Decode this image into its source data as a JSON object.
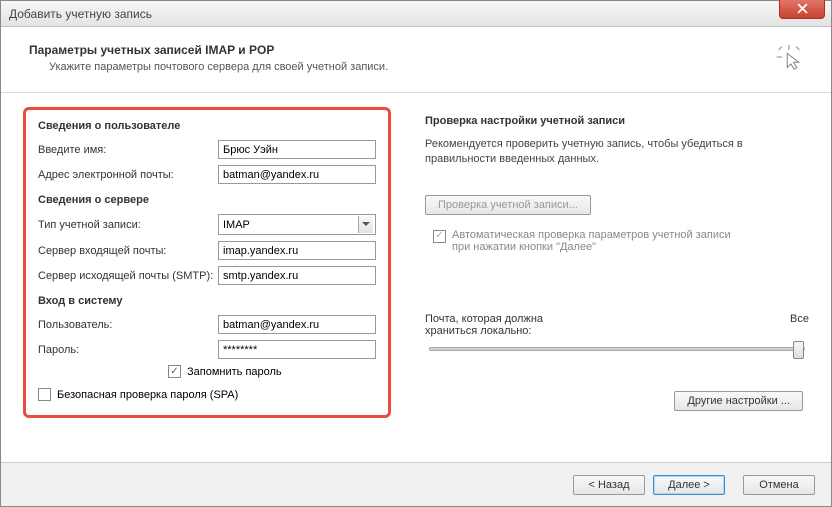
{
  "window": {
    "title": "Добавить учетную запись"
  },
  "header": {
    "title": "Параметры учетных записей IMAP и POP",
    "subtitle": "Укажите параметры почтового сервера для своей учетной записи."
  },
  "userSection": {
    "title": "Сведения о пользователе",
    "nameLabel": "Введите имя:",
    "nameValue": "Брюс Уэйн",
    "emailLabel": "Адрес электронной почты:",
    "emailValue": "batman@yandex.ru"
  },
  "serverSection": {
    "title": "Сведения о сервере",
    "typeLabel": "Тип учетной записи:",
    "typeValue": "IMAP",
    "incomingLabel": "Сервер входящей почты:",
    "incomingValue": "imap.yandex.ru",
    "outgoingLabel": "Сервер исходящей почты (SMTP):",
    "outgoingValue": "smtp.yandex.ru"
  },
  "loginSection": {
    "title": "Вход в систему",
    "userLabel": "Пользователь:",
    "userValue": "batman@yandex.ru",
    "passLabel": "Пароль:",
    "passValue": "********",
    "rememberLabel": "Запомнить пароль",
    "spaLabel": "Безопасная проверка пароля (SPA)"
  },
  "testSection": {
    "title": "Проверка настройки учетной записи",
    "desc": "Рекомендуется проверить учетную запись, чтобы убедиться в правильности введенных данных.",
    "testButton": "Проверка учетной записи...",
    "autoLabel": "Автоматическая проверка параметров учетной записи при нажатии кнопки \"Далее\""
  },
  "slider": {
    "leftLabel": "Почта, которая должна храниться локально:",
    "rightLabel": "Все"
  },
  "otherSettings": "Другие настройки ...",
  "footer": {
    "back": "< Назад",
    "next": "Далее >",
    "cancel": "Отмена"
  }
}
